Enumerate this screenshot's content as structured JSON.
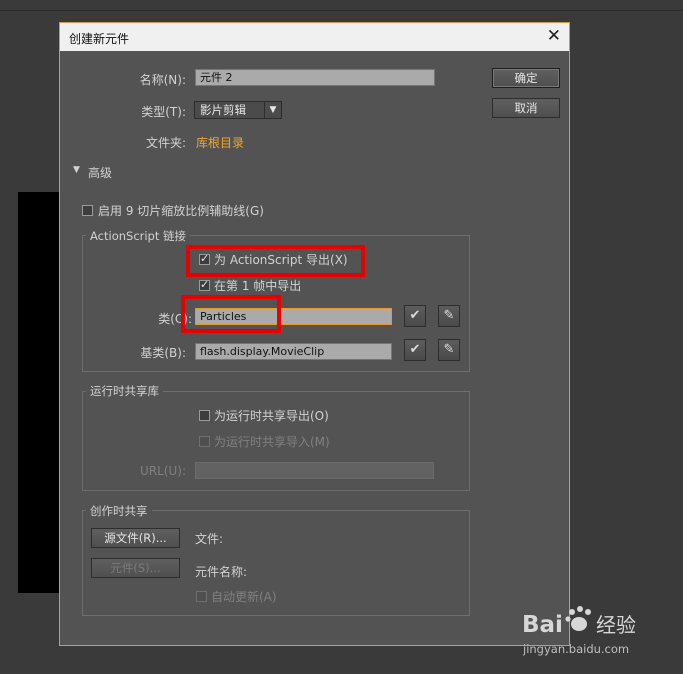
{
  "dialog": {
    "title": "创建新元件",
    "close_glyph": "✕"
  },
  "form": {
    "name_label": "名称(N):",
    "name_value": "元件 2",
    "type_label": "类型(T):",
    "type_value": "影片剪辑",
    "folder_label": "文件夹:",
    "folder_link": "库根目录"
  },
  "buttons": {
    "ok": "确定",
    "cancel": "取消"
  },
  "advanced": {
    "toggle_glyph": "▼",
    "label": "高级",
    "enable_9slice": "启用 9 切片缩放比例辅助线(G)"
  },
  "actionscript": {
    "group_title": "ActionScript 链接",
    "export_for_as": "为 ActionScript 导出(X)",
    "export_in_frame1": "在第 1 帧中导出",
    "class_label": "类(C):",
    "class_value": "Particles",
    "base_class_label": "基类(B):",
    "base_class_value": "flash.display.MovieClip"
  },
  "runtime_shared": {
    "group_title": "运行时共享库",
    "export_for_runtime": "为运行时共享导出(O)",
    "import_for_runtime": "为运行时共享导入(M)",
    "url_label": "URL(U):",
    "url_value": ""
  },
  "authoring_shared": {
    "group_title": "创作时共享",
    "source_file_button": "源文件(R)...",
    "symbol_button": "元件(S)...",
    "file_label": "文件:",
    "symbol_name_label": "元件名称:",
    "auto_update": "自动更新(A)"
  },
  "watermark": {
    "logo": "Bai经验",
    "url": "jingyan.baidu.com"
  },
  "colors": {
    "accent": "#f0a72a",
    "highlight_box": "#e80000",
    "dialog_bg": "#535353"
  }
}
